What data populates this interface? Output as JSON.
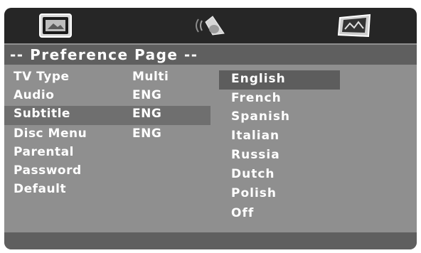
{
  "menu_tabs": [
    {
      "name": "general-setup",
      "icon": "tv-screen-icon"
    },
    {
      "name": "audio-setup",
      "icon": "speaker-icon"
    },
    {
      "name": "preference-setup",
      "icon": "picture-frame-icon"
    }
  ],
  "page_title": "-- Preference Page --",
  "settings": [
    {
      "label": "TV Type",
      "value": "Multi"
    },
    {
      "label": "Audio",
      "value": "ENG"
    },
    {
      "label": "Subtitle",
      "value": "ENG"
    },
    {
      "label": "Disc Menu",
      "value": "ENG"
    },
    {
      "label": "Parental",
      "value": ""
    },
    {
      "label": "Password",
      "value": ""
    },
    {
      "label": "Default",
      "value": ""
    }
  ],
  "selected_setting": "Subtitle",
  "options": [
    "English",
    "French",
    "Spanish",
    "Italian",
    "Russia",
    "Dutch",
    "Polish",
    "Off"
  ],
  "highlighted_option": "English",
  "colors": {
    "panel": "#8f8f8f",
    "top_bar": "#262626",
    "title_bar": "#5f5f5f",
    "selection": "#6f6f6f",
    "text": "#ffffff"
  }
}
